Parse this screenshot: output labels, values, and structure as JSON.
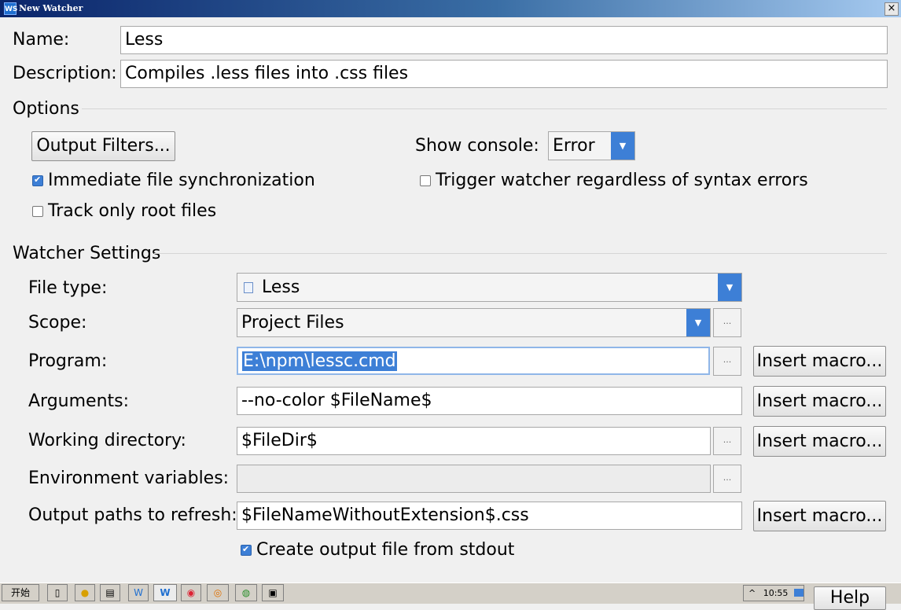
{
  "window": {
    "title": "New Watcher",
    "app_logo": "WS",
    "close_label": "×"
  },
  "name": {
    "label": "Name:",
    "value": "Less"
  },
  "description": {
    "label": "Description:",
    "value": "Compiles .less files into .css files"
  },
  "options": {
    "title": "Options",
    "output_filters_label": "Output Filters...",
    "show_console_label": "Show console:",
    "show_console_value": "Error",
    "immediate_sync_label": "Immediate file synchronization",
    "immediate_sync_checked": true,
    "track_root_label": "Track only root files",
    "track_root_checked": false,
    "trigger_label": "Trigger watcher regardless of syntax errors",
    "trigger_checked": false
  },
  "watcher": {
    "title": "Watcher Settings",
    "file_type_label": "File type:",
    "file_type_value": "Less",
    "scope_label": "Scope:",
    "scope_value": "Project Files",
    "program_label": "Program:",
    "program_value": "E:\\npm\\lessc.cmd",
    "arguments_label": "Arguments:",
    "arguments_value": "--no-color $FileName$",
    "working_dir_label": "Working directory:",
    "working_dir_value": "$FileDir$",
    "env_label": "Environment variables:",
    "env_value": "",
    "output_paths_label": "Output paths to refresh:",
    "output_paths_value": "$FileNameWithoutExtension$.css",
    "insert_macro_label": "Insert macro...",
    "browse_label": "...",
    "create_output_label": "Create output file from stdout",
    "create_output_checked": true
  },
  "taskbar": {
    "start_label": "开始",
    "clock": "10:55",
    "tray_arrow": "^"
  },
  "help_label": "Help",
  "colors": {
    "accent": "#3d7fd6",
    "title_bar": "#0a246a"
  }
}
